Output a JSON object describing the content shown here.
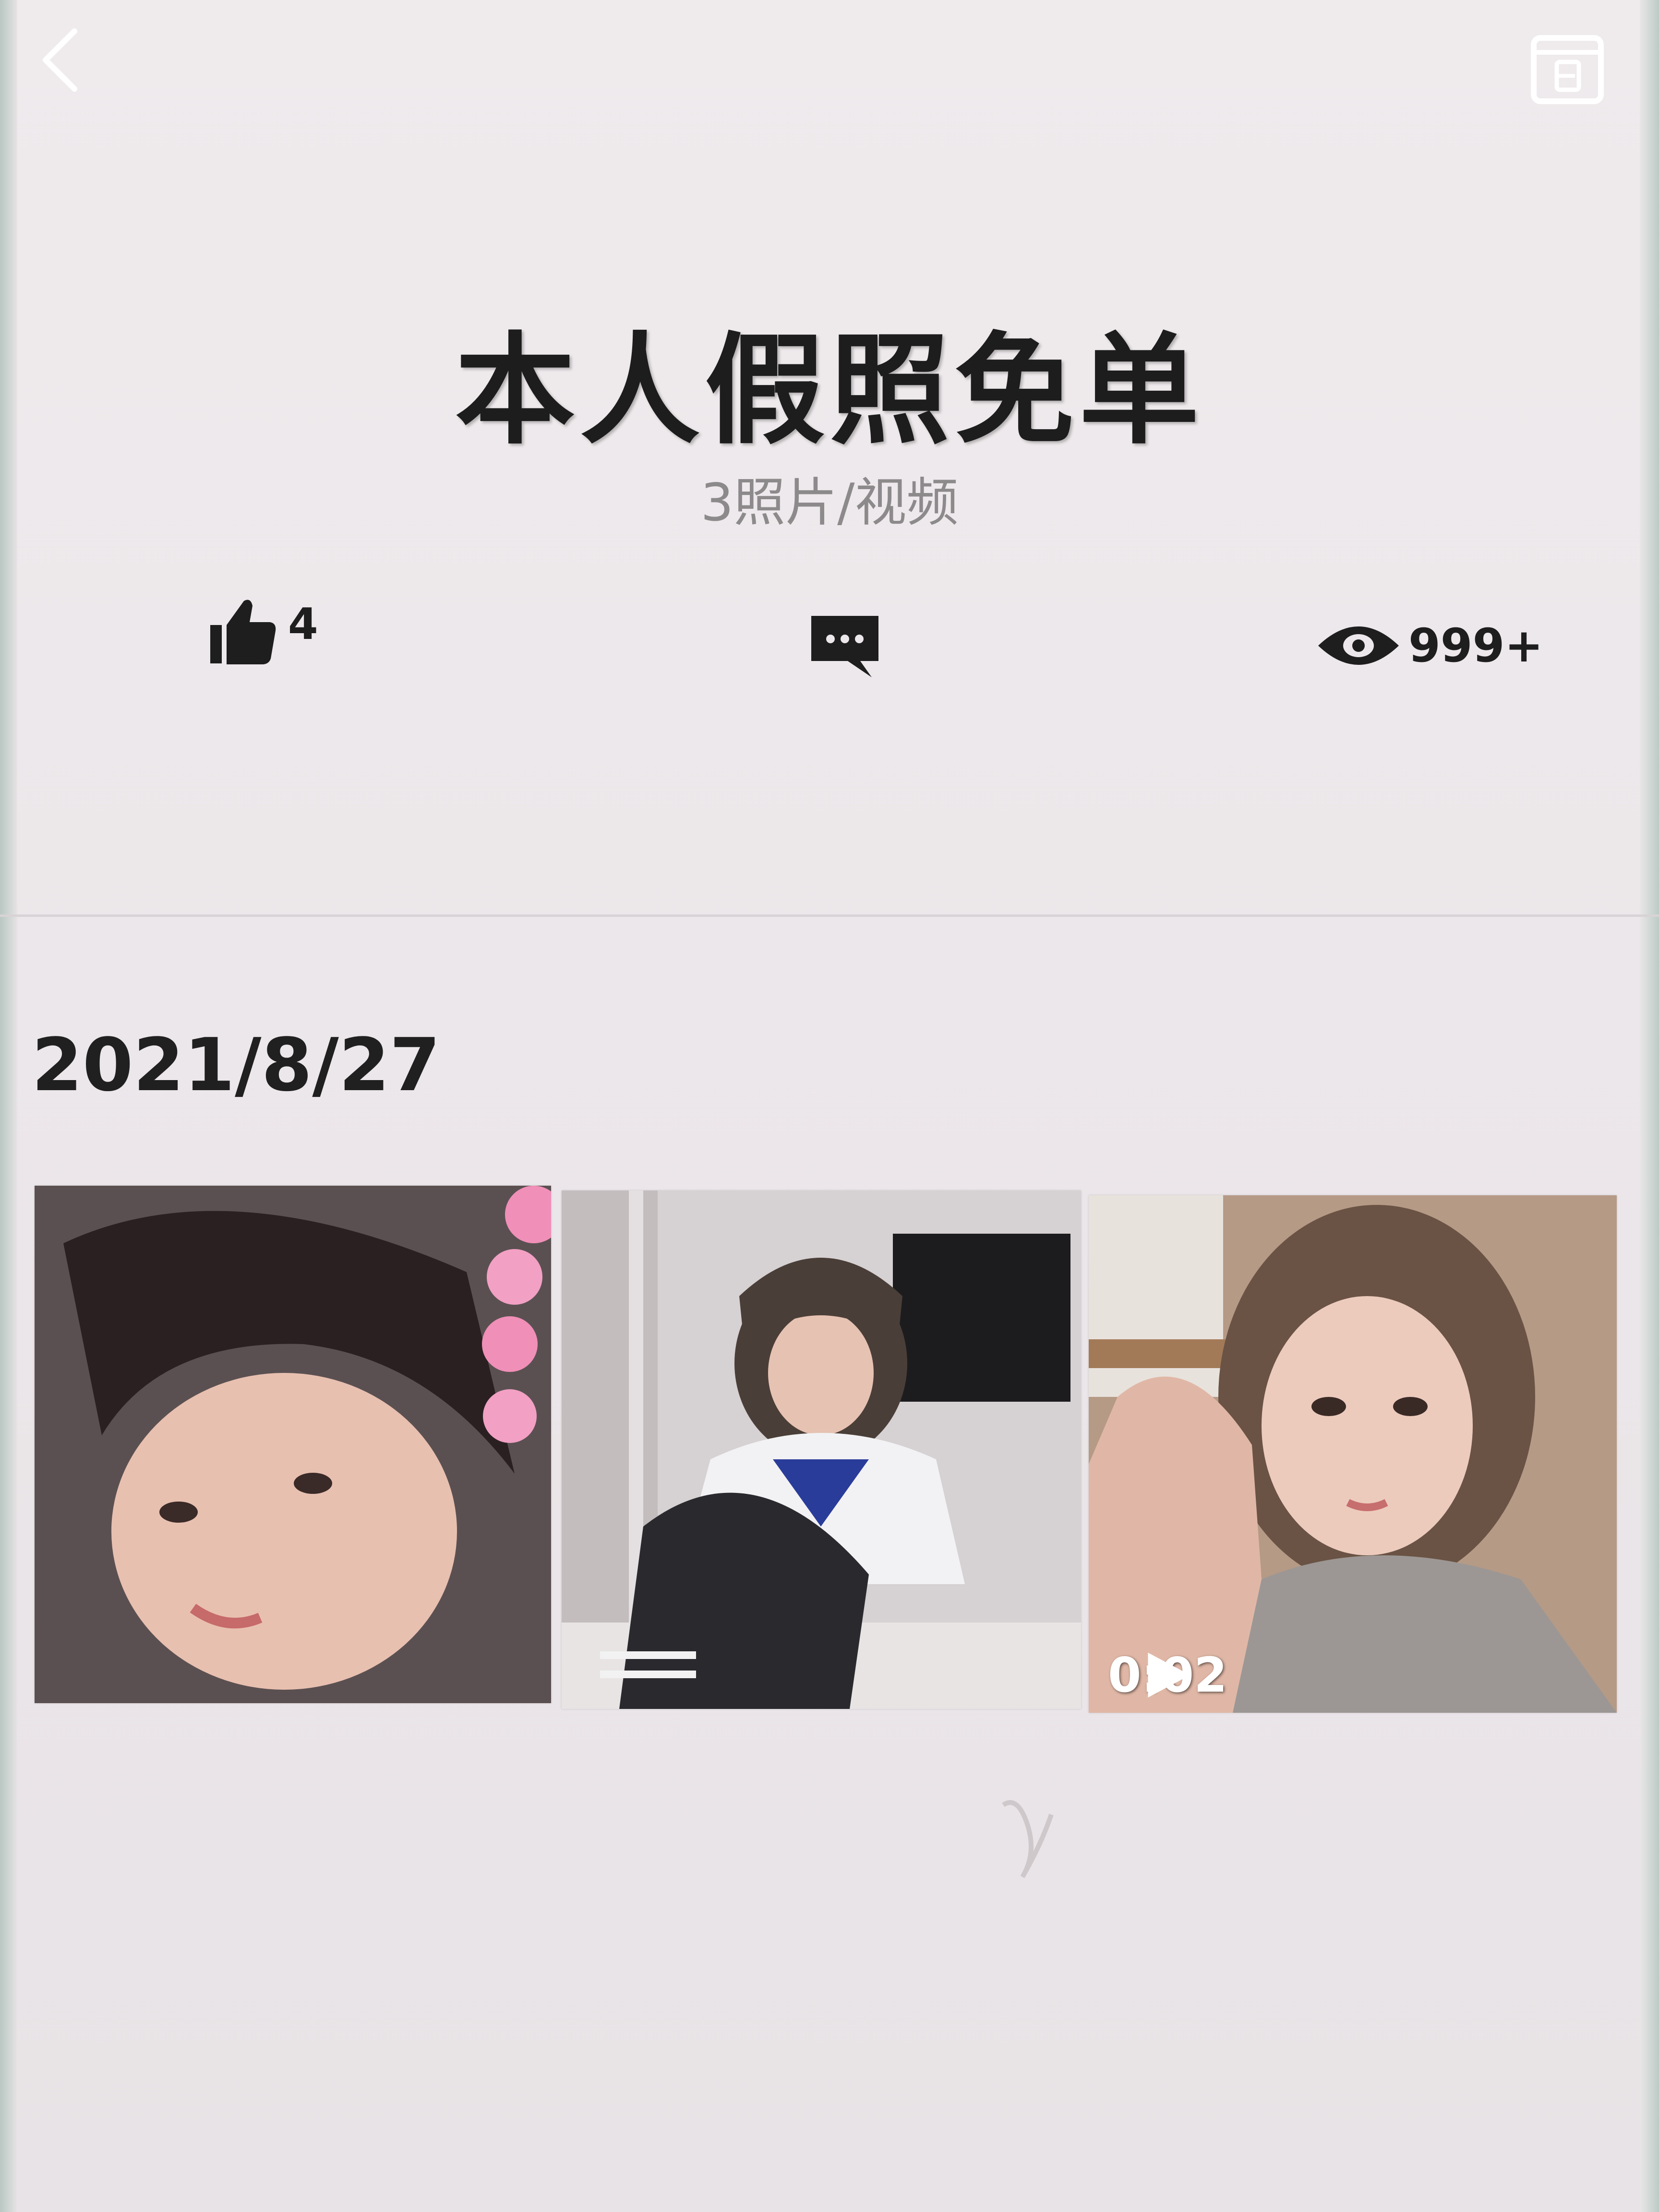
{
  "album": {
    "title": "本人假照免单",
    "subtitle": "3照片/视频"
  },
  "stats": {
    "likes": "4",
    "views": "999+"
  },
  "section": {
    "date": "2021/8/27"
  },
  "media": [
    {
      "type": "photo"
    },
    {
      "type": "photo"
    },
    {
      "type": "video",
      "duration": "0:02"
    }
  ],
  "icons": {
    "back": "chevron-left-icon",
    "album": "calendar-b-icon",
    "like": "thumbs-up-icon",
    "comment": "comment-icon",
    "views": "eye-icon",
    "play": "play-icon"
  },
  "colors": {
    "background": "#ece7ea",
    "text": "#1d1d1d",
    "muted": "#8d8a8c"
  }
}
